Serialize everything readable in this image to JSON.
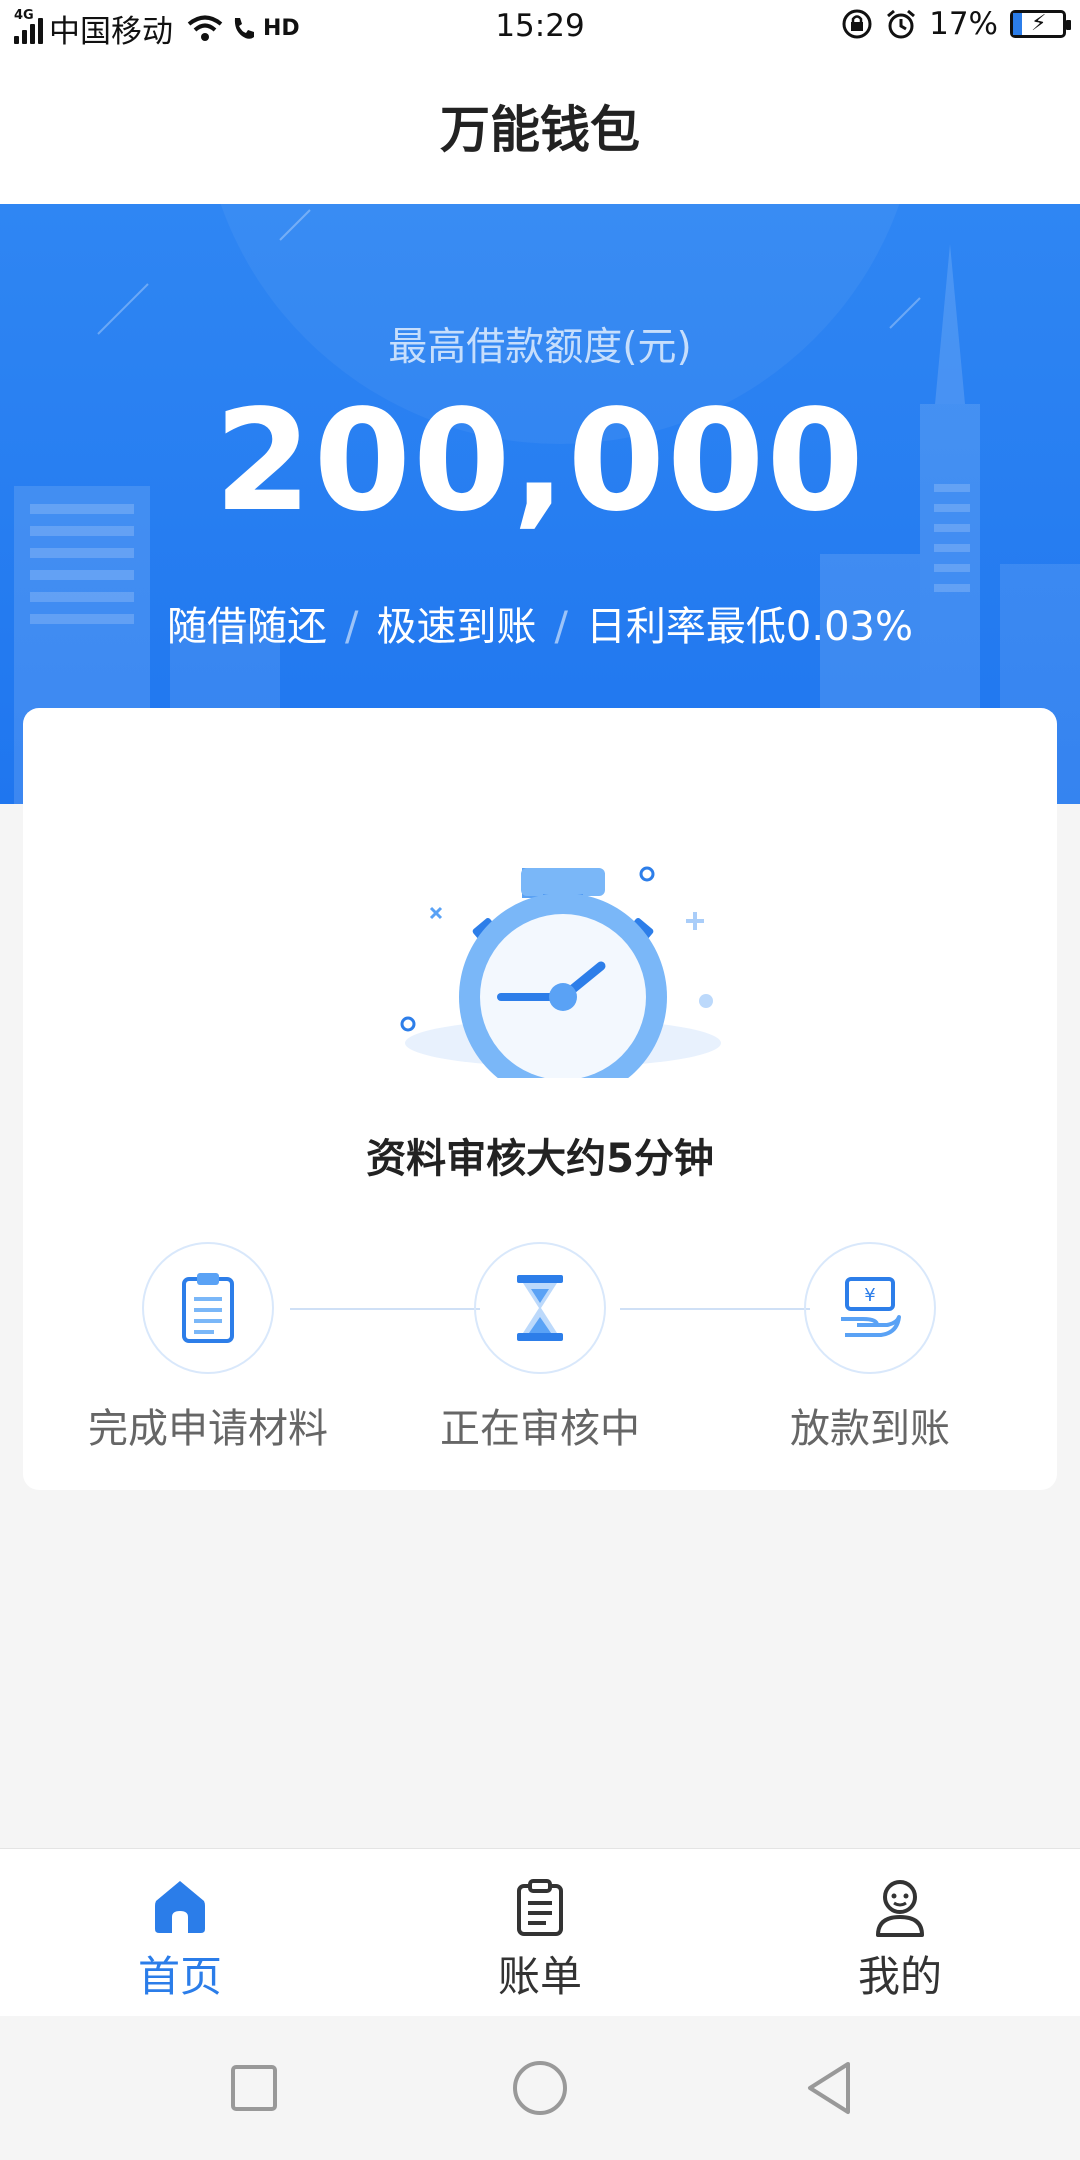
{
  "status_bar": {
    "network_type": "4G",
    "carrier": "中国移动",
    "hd": "HD",
    "time": "15:29",
    "battery_percent": "17%",
    "battery_level": 0.17
  },
  "title": "万能钱包",
  "banner": {
    "label": "最高借款额度(元)",
    "amount": "200,000",
    "features": [
      "随借随还",
      "极速到账",
      "日利率最低0.03%"
    ],
    "separator": "/"
  },
  "card": {
    "headline": "资料审核大约5分钟",
    "steps": [
      {
        "label": "完成申请材料",
        "icon": "clipboard-icon"
      },
      {
        "label": "正在审核中",
        "icon": "hourglass-icon"
      },
      {
        "label": "放款到账",
        "icon": "money-hand-icon"
      }
    ]
  },
  "tabbar": {
    "items": [
      {
        "label": "首页",
        "icon": "home-icon",
        "active": true
      },
      {
        "label": "账单",
        "icon": "bill-icon",
        "active": false
      },
      {
        "label": "我的",
        "icon": "profile-icon",
        "active": false
      }
    ]
  },
  "colors": {
    "primary": "#2b7de9",
    "banner_top": "#2f86f3",
    "banner_bottom": "#1f76ef",
    "background": "#f5f5f5"
  }
}
